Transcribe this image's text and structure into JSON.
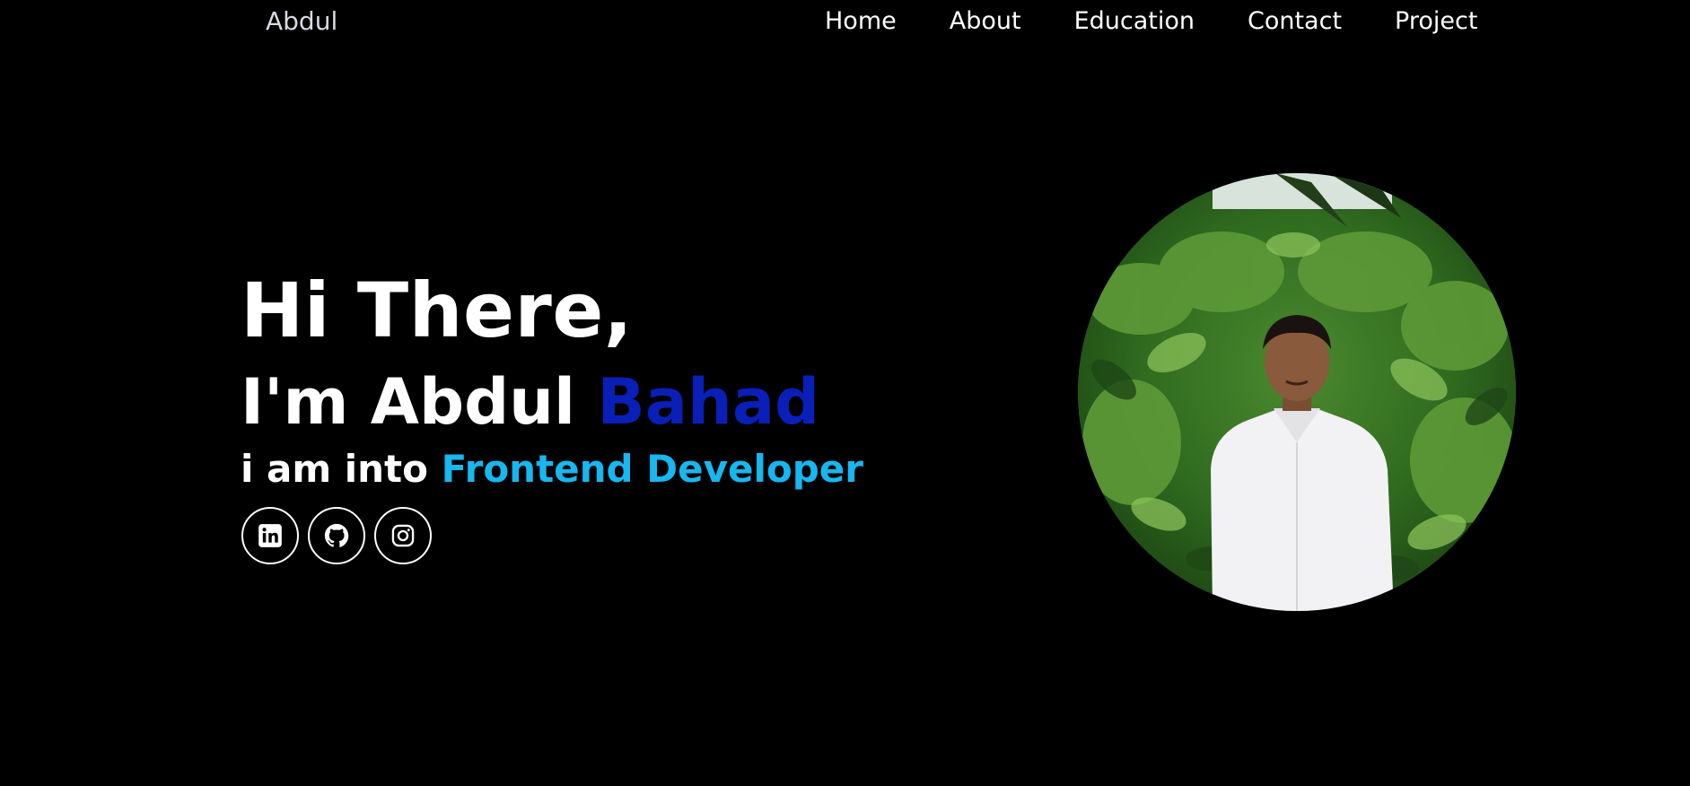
{
  "header": {
    "brand": "Abdul",
    "nav": [
      {
        "label": "Home"
      },
      {
        "label": "About"
      },
      {
        "label": "Education"
      },
      {
        "label": "Contact"
      },
      {
        "label": "Project"
      }
    ]
  },
  "hero": {
    "greeting": "Hi There,",
    "intro_prefix": "I'm Abdul",
    "intro_highlight": "Bahad",
    "role_prefix": "i am into",
    "role_highlight": "Frontend Developer"
  },
  "socials": [
    {
      "icon": "linkedin-icon"
    },
    {
      "icon": "github-icon"
    },
    {
      "icon": "instagram-icon"
    }
  ],
  "colors": {
    "background": "#000000",
    "name_accent": "#0a1fb8",
    "role_accent": "#17b7ef",
    "text": "#ffffff"
  }
}
